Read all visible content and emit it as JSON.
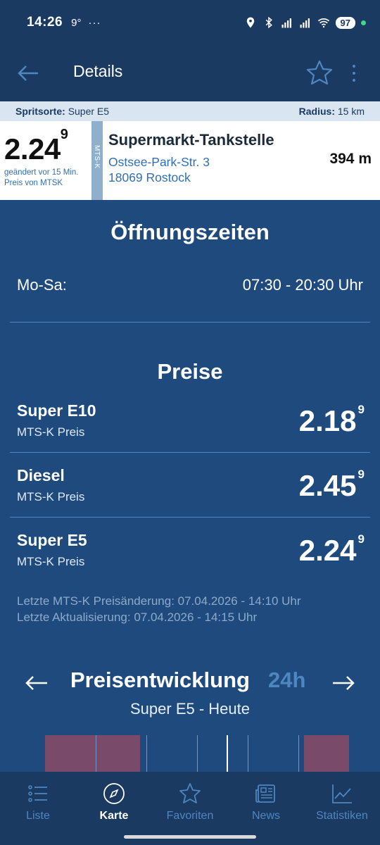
{
  "status": {
    "time": "14:26",
    "temp": "9°",
    "dots": "···",
    "battery": "97"
  },
  "appbar": {
    "title": "Details"
  },
  "subbar": {
    "fuel_label": "Spritsorte:",
    "fuel_value": "Super E5",
    "radius_label": "Radius:",
    "radius_value": "15 km"
  },
  "station": {
    "price_main": "2.24",
    "price_sup": "9",
    "changed": "geändert vor 15 Min.",
    "source": "Preis von MTSK",
    "side_label": "MTS-K",
    "name": "Supermarkt-Tankstelle",
    "street": "Ostsee-Park-Str. 3",
    "city": "18069 Rostock",
    "distance": "394 m"
  },
  "hours": {
    "title": "Öffnungszeiten",
    "days": "Mo-Sa:",
    "time": "07:30 - 20:30 Uhr"
  },
  "prices": {
    "title": "Preise",
    "items": [
      {
        "name": "Super E10",
        "sub": "MTS-K Preis",
        "main": "2.18",
        "sup": "9"
      },
      {
        "name": "Diesel",
        "sub": "MTS-K Preis",
        "main": "2.45",
        "sup": "9"
      },
      {
        "name": "Super E5",
        "sub": "MTS-K Preis",
        "main": "2.24",
        "sup": "9"
      }
    ],
    "last_change": "Letzte MTS-K Preisänderung: 07.04.2026 - 14:10 Uhr",
    "last_update": "Letzte Aktualisierung: 07.04.2026 - 14:15 Uhr"
  },
  "trend": {
    "title": "Preisentwicklung",
    "badge": "24h",
    "subtitle": "Super E5 - Heute"
  },
  "nav": [
    {
      "label": "Liste",
      "icon": "list-icon"
    },
    {
      "label": "Karte",
      "icon": "compass-icon"
    },
    {
      "label": "Favoriten",
      "icon": "star-icon"
    },
    {
      "label": "News",
      "icon": "newspaper-icon"
    },
    {
      "label": "Statistiken",
      "icon": "chart-icon"
    }
  ],
  "colors": {
    "background": "#1e4a7e",
    "bar": "#1a3a62",
    "accent": "#4e86c0",
    "chart_bar": "#7a4a6a"
  }
}
